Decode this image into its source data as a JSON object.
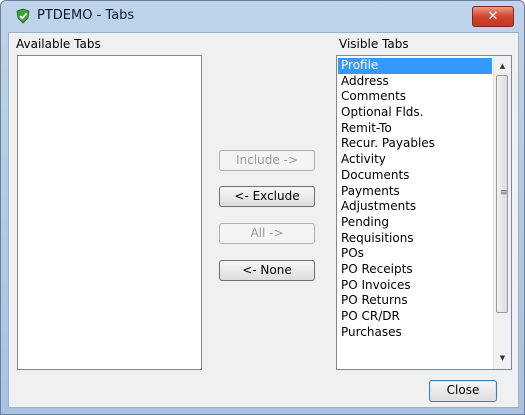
{
  "window": {
    "title": "PTDEMO - Tabs",
    "close_glyph": "✕",
    "app_icon": "check-shield-icon"
  },
  "available": {
    "label": "Available Tabs",
    "items": []
  },
  "visible": {
    "label": "Visible Tabs",
    "items": [
      "Profile",
      "Address",
      "Comments",
      "Optional Flds.",
      "Remit-To",
      "Recur. Payables",
      "Activity",
      "Documents",
      "Payments",
      "Adjustments",
      "Pending",
      "Requisitions",
      "POs",
      "PO Receipts",
      "PO Invoices",
      "PO Returns",
      "PO CR/DR",
      "Purchases"
    ],
    "selected_index": 0
  },
  "buttons": {
    "include": "Include ->",
    "exclude": "<- Exclude",
    "all": "All ->",
    "none": "<- None",
    "close": "Close"
  },
  "scrollbar": {
    "up_glyph": "▲",
    "down_glyph": "▼",
    "grip_glyph": "≡"
  },
  "colors": {
    "selection": "#3399ff",
    "title_bar": "#bfd3ea",
    "close_button": "#d2452d"
  }
}
